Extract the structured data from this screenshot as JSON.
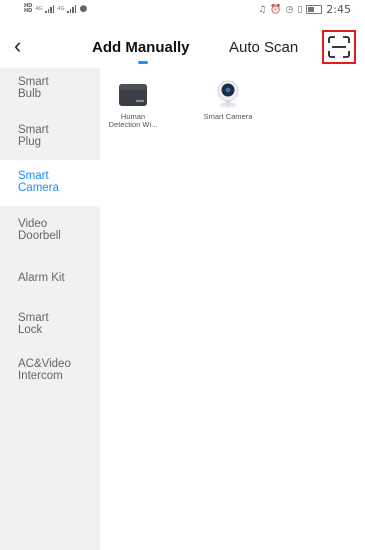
{
  "status_bar": {
    "left_small_labels": [
      "HD",
      "HD"
    ],
    "left_tiny_1": "4G",
    "left_tiny_2": "4G",
    "right_icons": [
      "headset-icon",
      "alarm-icon",
      "clock-icon",
      "vibrate-icon",
      "battery-icon"
    ],
    "time": "2:45"
  },
  "header": {
    "back_icon": "chevron-left-icon",
    "tabs": [
      {
        "label": "Add Manually",
        "active": true
      },
      {
        "label": "Auto Scan",
        "active": false
      }
    ],
    "scan_icon": "qr-scan-icon",
    "accent_color": "#1e90ff",
    "highlight_color": "#e21b1b"
  },
  "sidebar": {
    "items": [
      {
        "label": "Smart\nBulb",
        "active": false
      },
      {
        "label": "Smart\nPlug",
        "active": false
      },
      {
        "label": "Smart\nCamera",
        "active": true
      },
      {
        "label": "Video\nDoorbell",
        "active": false
      },
      {
        "label": "Alarm Kit",
        "active": false
      },
      {
        "label": "Smart\nLock",
        "active": false
      },
      {
        "label": "AC&Video\nIntercom",
        "active": false
      }
    ]
  },
  "devices": [
    {
      "label": "Human\nDetection Wi...",
      "icon": "human-detection-camera-icon"
    },
    {
      "label": "Smart Camera",
      "icon": "smart-camera-icon"
    }
  ]
}
